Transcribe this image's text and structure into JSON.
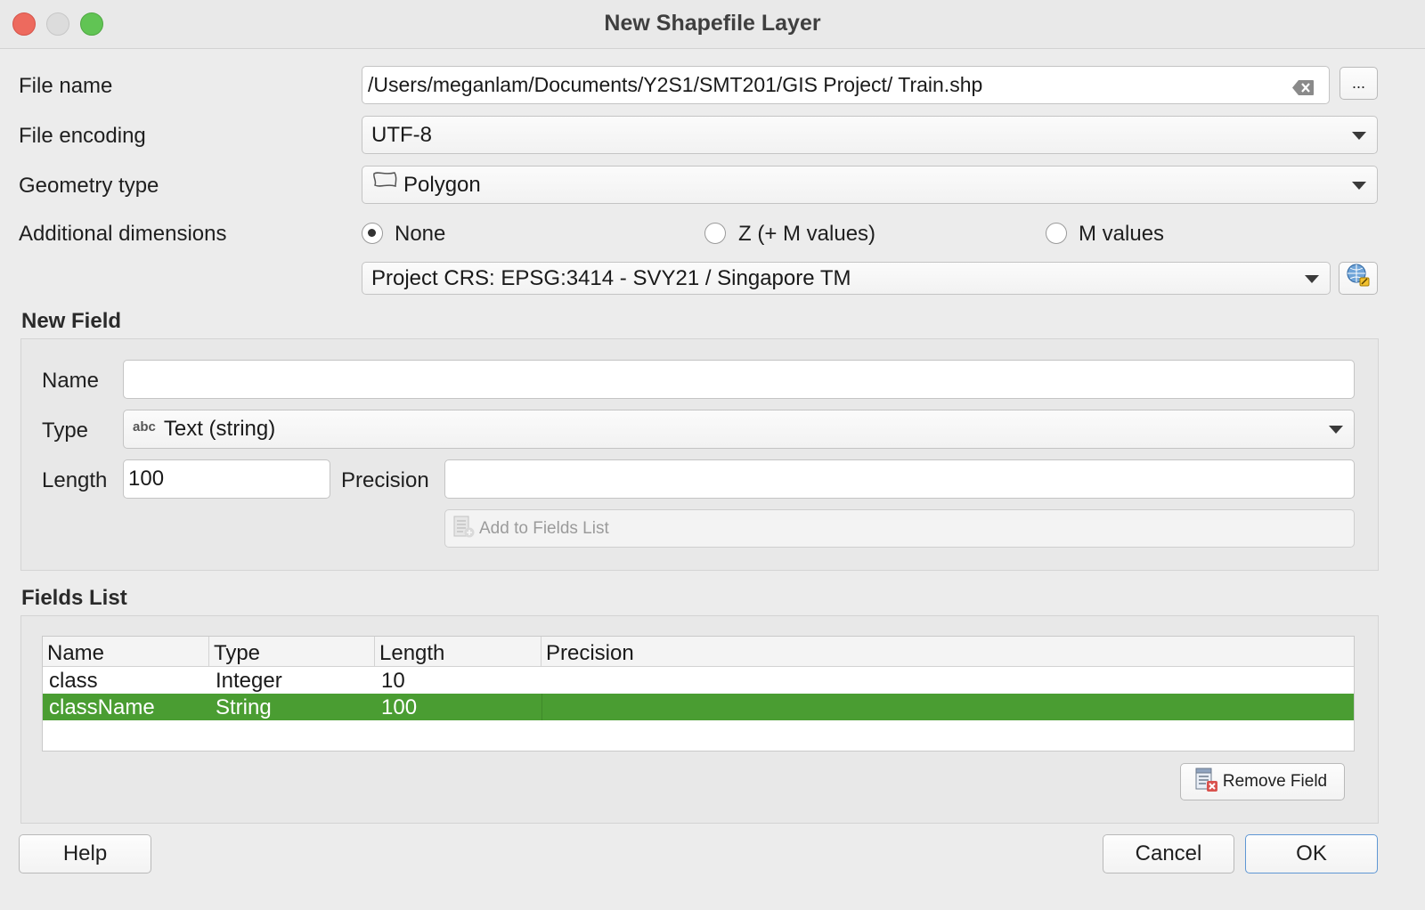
{
  "window": {
    "title": "New Shapefile Layer"
  },
  "form": {
    "file_name_label": "File name",
    "file_name_value": "/Users/meganlam/Documents/Y2S1/SMT201/GIS Project/ Train.shp",
    "browse_label": "...",
    "file_encoding_label": "File encoding",
    "file_encoding_value": "UTF-8",
    "geometry_type_label": "Geometry type",
    "geometry_type_value": "Polygon",
    "geometry_icon": "polygon-icon",
    "additional_dimensions_label": "Additional dimensions",
    "dimensions": [
      {
        "label": "None",
        "checked": true
      },
      {
        "label": "Z (+ M values)",
        "checked": false
      },
      {
        "label": "M values",
        "checked": false
      }
    ],
    "crs_value": "Project CRS: EPSG:3414 - SVY21 / Singapore TM",
    "crs_icon": "crs-selector-icon"
  },
  "new_field": {
    "title": "New Field",
    "name_label": "Name",
    "name_value": "",
    "type_label": "Type",
    "type_icon_text": "abc",
    "type_value": "Text (string)",
    "length_label": "Length",
    "length_value": "100",
    "precision_label": "Precision",
    "precision_value": "",
    "add_button_label": "Add to Fields List"
  },
  "fields_list": {
    "title": "Fields List",
    "columns": [
      "Name",
      "Type",
      "Length",
      "Precision"
    ],
    "rows": [
      {
        "name": "class",
        "type": "Integer",
        "length": "10",
        "precision": "",
        "selected": false
      },
      {
        "name": "className",
        "type": "String",
        "length": "100",
        "precision": "",
        "selected": true
      }
    ],
    "remove_button_label": "Remove Field",
    "selection_color": "#4a9d32"
  },
  "footer": {
    "help_label": "Help",
    "cancel_label": "Cancel",
    "ok_label": "OK"
  }
}
